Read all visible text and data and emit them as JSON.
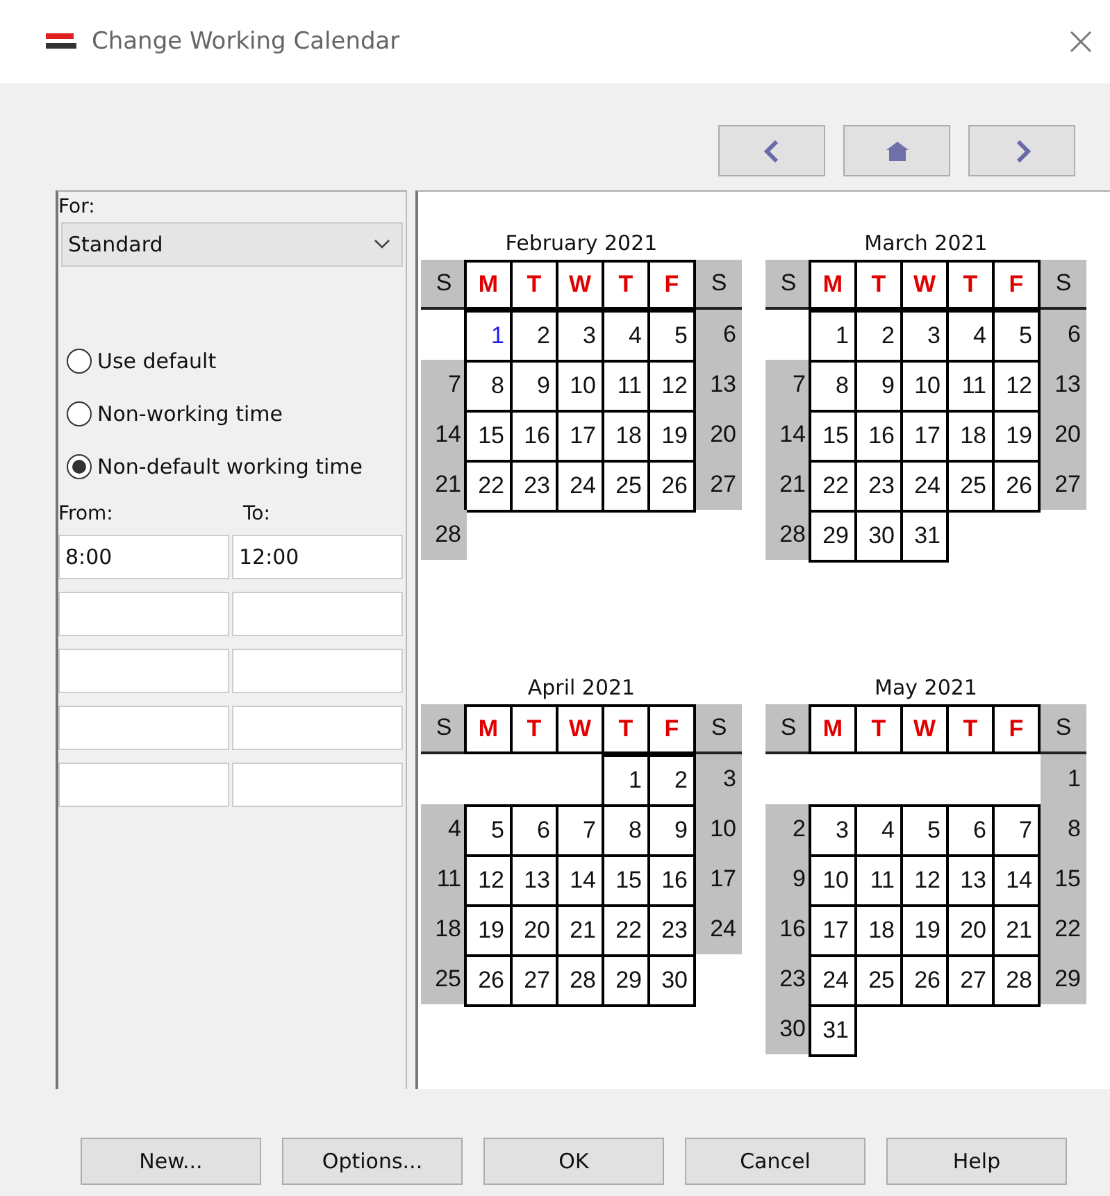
{
  "window": {
    "title": "Change Working Calendar"
  },
  "nav_buttons": [
    {
      "kind": "prev"
    },
    {
      "kind": "home"
    },
    {
      "kind": "next"
    }
  ],
  "for_label": "For:",
  "calendar_select": {
    "value": "Standard"
  },
  "options": [
    {
      "label": "Use default",
      "selected": false
    },
    {
      "label": "Non-working time",
      "selected": false
    },
    {
      "label": "Non-default working time",
      "selected": true
    }
  ],
  "from_label": "From:",
  "to_label": "To:",
  "time_rows": [
    {
      "from": "8:00",
      "to": "12:00"
    },
    {},
    {},
    {},
    {}
  ],
  "months": [
    {
      "title": "February 2021",
      "headers": [
        {
          "label": "S",
          "kind": "weekend"
        },
        {
          "label": "M",
          "kind": "workday"
        },
        {
          "label": "T",
          "kind": "workday"
        },
        {
          "label": "W",
          "kind": "workday"
        },
        {
          "label": "T",
          "kind": "workday"
        },
        {
          "label": "F",
          "kind": "workday"
        },
        {
          "label": "S",
          "kind": "weekend"
        }
      ],
      "days": [
        {
          "day": "1",
          "kind": "mon",
          "today": true
        },
        {
          "day": "2",
          "kind": "tue",
          "today": false
        },
        {
          "day": "3",
          "kind": "wed",
          "today": false
        },
        {
          "day": "4",
          "kind": "thu",
          "today": false
        },
        {
          "day": "5",
          "kind": "fri",
          "today": false
        },
        {
          "day": "6",
          "kind": "sat",
          "today": false
        },
        {
          "day": "7",
          "kind": "sun",
          "today": false
        },
        {
          "day": "8",
          "kind": "mon",
          "today": false
        },
        {
          "day": "9",
          "kind": "tue",
          "today": false
        },
        {
          "day": "10",
          "kind": "wed",
          "today": false
        },
        {
          "day": "11",
          "kind": "thu",
          "today": false
        },
        {
          "day": "12",
          "kind": "fri",
          "today": false
        },
        {
          "day": "13",
          "kind": "sat",
          "today": false
        },
        {
          "day": "14",
          "kind": "sun",
          "today": false
        },
        {
          "day": "15",
          "kind": "mon",
          "today": false
        },
        {
          "day": "16",
          "kind": "tue",
          "today": false
        },
        {
          "day": "17",
          "kind": "wed",
          "today": false
        },
        {
          "day": "18",
          "kind": "thu",
          "today": false
        },
        {
          "day": "19",
          "kind": "fri",
          "today": false
        },
        {
          "day": "20",
          "kind": "sat",
          "today": false
        },
        {
          "day": "21",
          "kind": "sun",
          "today": false
        },
        {
          "day": "22",
          "kind": "mon",
          "today": false
        },
        {
          "day": "23",
          "kind": "tue",
          "today": false
        },
        {
          "day": "24",
          "kind": "wed",
          "today": false
        },
        {
          "day": "25",
          "kind": "thu",
          "today": false
        },
        {
          "day": "26",
          "kind": "fri",
          "today": false
        },
        {
          "day": "27",
          "kind": "sat",
          "today": false
        },
        {
          "day": "28",
          "kind": "sun",
          "today": false
        }
      ]
    },
    {
      "title": "March 2021",
      "headers": [
        {
          "label": "S",
          "kind": "weekend"
        },
        {
          "label": "M",
          "kind": "workday"
        },
        {
          "label": "T",
          "kind": "workday"
        },
        {
          "label": "W",
          "kind": "workday"
        },
        {
          "label": "T",
          "kind": "workday"
        },
        {
          "label": "F",
          "kind": "workday"
        },
        {
          "label": "S",
          "kind": "weekend"
        }
      ],
      "days": [
        {
          "day": "1",
          "kind": "mon",
          "today": false
        },
        {
          "day": "2",
          "kind": "tue",
          "today": false
        },
        {
          "day": "3",
          "kind": "wed",
          "today": false
        },
        {
          "day": "4",
          "kind": "thu",
          "today": false
        },
        {
          "day": "5",
          "kind": "fri",
          "today": false
        },
        {
          "day": "6",
          "kind": "sat",
          "today": false
        },
        {
          "day": "7",
          "kind": "sun",
          "today": false
        },
        {
          "day": "8",
          "kind": "mon",
          "today": false
        },
        {
          "day": "9",
          "kind": "tue",
          "today": false
        },
        {
          "day": "10",
          "kind": "wed",
          "today": false
        },
        {
          "day": "11",
          "kind": "thu",
          "today": false
        },
        {
          "day": "12",
          "kind": "fri",
          "today": false
        },
        {
          "day": "13",
          "kind": "sat",
          "today": false
        },
        {
          "day": "14",
          "kind": "sun",
          "today": false
        },
        {
          "day": "15",
          "kind": "mon",
          "today": false
        },
        {
          "day": "16",
          "kind": "tue",
          "today": false
        },
        {
          "day": "17",
          "kind": "wed",
          "today": false
        },
        {
          "day": "18",
          "kind": "thu",
          "today": false
        },
        {
          "day": "19",
          "kind": "fri",
          "today": false
        },
        {
          "day": "20",
          "kind": "sat",
          "today": false
        },
        {
          "day": "21",
          "kind": "sun",
          "today": false
        },
        {
          "day": "22",
          "kind": "mon",
          "today": false
        },
        {
          "day": "23",
          "kind": "tue",
          "today": false
        },
        {
          "day": "24",
          "kind": "wed",
          "today": false
        },
        {
          "day": "25",
          "kind": "thu",
          "today": false
        },
        {
          "day": "26",
          "kind": "fri",
          "today": false
        },
        {
          "day": "27",
          "kind": "sat",
          "today": false
        },
        {
          "day": "28",
          "kind": "sun",
          "today": false
        },
        {
          "day": "29",
          "kind": "mon",
          "today": false
        },
        {
          "day": "30",
          "kind": "tue",
          "today": false
        },
        {
          "day": "31",
          "kind": "wed",
          "today": false
        }
      ]
    },
    {
      "title": "April 2021",
      "headers": [
        {
          "label": "S",
          "kind": "weekend"
        },
        {
          "label": "M",
          "kind": "workday"
        },
        {
          "label": "T",
          "kind": "workday"
        },
        {
          "label": "W",
          "kind": "workday"
        },
        {
          "label": "T",
          "kind": "workday"
        },
        {
          "label": "F",
          "kind": "workday"
        },
        {
          "label": "S",
          "kind": "weekend"
        }
      ],
      "days": [
        {
          "day": "1",
          "kind": "thu",
          "today": false
        },
        {
          "day": "2",
          "kind": "fri",
          "today": false
        },
        {
          "day": "3",
          "kind": "sat",
          "today": false
        },
        {
          "day": "4",
          "kind": "sun",
          "today": false
        },
        {
          "day": "5",
          "kind": "mon",
          "today": false
        },
        {
          "day": "6",
          "kind": "tue",
          "today": false
        },
        {
          "day": "7",
          "kind": "wed",
          "today": false
        },
        {
          "day": "8",
          "kind": "thu",
          "today": false
        },
        {
          "day": "9",
          "kind": "fri",
          "today": false
        },
        {
          "day": "10",
          "kind": "sat",
          "today": false
        },
        {
          "day": "11",
          "kind": "sun",
          "today": false
        },
        {
          "day": "12",
          "kind": "mon",
          "today": false
        },
        {
          "day": "13",
          "kind": "tue",
          "today": false
        },
        {
          "day": "14",
          "kind": "wed",
          "today": false
        },
        {
          "day": "15",
          "kind": "thu",
          "today": false
        },
        {
          "day": "16",
          "kind": "fri",
          "today": false
        },
        {
          "day": "17",
          "kind": "sat",
          "today": false
        },
        {
          "day": "18",
          "kind": "sun",
          "today": false
        },
        {
          "day": "19",
          "kind": "mon",
          "today": false
        },
        {
          "day": "20",
          "kind": "tue",
          "today": false
        },
        {
          "day": "21",
          "kind": "wed",
          "today": false
        },
        {
          "day": "22",
          "kind": "thu",
          "today": false
        },
        {
          "day": "23",
          "kind": "fri",
          "today": false
        },
        {
          "day": "24",
          "kind": "sat",
          "today": false
        },
        {
          "day": "25",
          "kind": "sun",
          "today": false
        },
        {
          "day": "26",
          "kind": "mon",
          "today": false
        },
        {
          "day": "27",
          "kind": "tue",
          "today": false
        },
        {
          "day": "28",
          "kind": "wed",
          "today": false
        },
        {
          "day": "29",
          "kind": "thu",
          "today": false
        },
        {
          "day": "30",
          "kind": "fri",
          "today": false
        }
      ]
    },
    {
      "title": "May 2021",
      "headers": [
        {
          "label": "S",
          "kind": "weekend"
        },
        {
          "label": "M",
          "kind": "workday"
        },
        {
          "label": "T",
          "kind": "workday"
        },
        {
          "label": "W",
          "kind": "workday"
        },
        {
          "label": "T",
          "kind": "workday"
        },
        {
          "label": "F",
          "kind": "workday"
        },
        {
          "label": "S",
          "kind": "weekend"
        }
      ],
      "days": [
        {
          "day": "1",
          "kind": "sat",
          "today": false
        },
        {
          "day": "2",
          "kind": "sun",
          "today": false
        },
        {
          "day": "3",
          "kind": "mon",
          "today": false
        },
        {
          "day": "4",
          "kind": "tue",
          "today": false
        },
        {
          "day": "5",
          "kind": "wed",
          "today": false
        },
        {
          "day": "6",
          "kind": "thu",
          "today": false
        },
        {
          "day": "7",
          "kind": "fri",
          "today": false
        },
        {
          "day": "8",
          "kind": "sat",
          "today": false
        },
        {
          "day": "9",
          "kind": "sun",
          "today": false
        },
        {
          "day": "10",
          "kind": "mon",
          "today": false
        },
        {
          "day": "11",
          "kind": "tue",
          "today": false
        },
        {
          "day": "12",
          "kind": "wed",
          "today": false
        },
        {
          "day": "13",
          "kind": "thu",
          "today": false
        },
        {
          "day": "14",
          "kind": "fri",
          "today": false
        },
        {
          "day": "15",
          "kind": "sat",
          "today": false
        },
        {
          "day": "16",
          "kind": "sun",
          "today": false
        },
        {
          "day": "17",
          "kind": "mon",
          "today": false
        },
        {
          "day": "18",
          "kind": "tue",
          "today": false
        },
        {
          "day": "19",
          "kind": "wed",
          "today": false
        },
        {
          "day": "20",
          "kind": "thu",
          "today": false
        },
        {
          "day": "21",
          "kind": "fri",
          "today": false
        },
        {
          "day": "22",
          "kind": "sat",
          "today": false
        },
        {
          "day": "23",
          "kind": "sun",
          "today": false
        },
        {
          "day": "24",
          "kind": "mon",
          "today": false
        },
        {
          "day": "25",
          "kind": "tue",
          "today": false
        },
        {
          "day": "26",
          "kind": "wed",
          "today": false
        },
        {
          "day": "27",
          "kind": "thu",
          "today": false
        },
        {
          "day": "28",
          "kind": "fri",
          "today": false
        },
        {
          "day": "29",
          "kind": "sat",
          "today": false
        },
        {
          "day": "30",
          "kind": "sun",
          "today": false
        },
        {
          "day": "31",
          "kind": "mon",
          "today": false
        }
      ]
    }
  ],
  "buttons": [
    "New...",
    "Options...",
    "OK",
    "Cancel",
    "Help"
  ]
}
